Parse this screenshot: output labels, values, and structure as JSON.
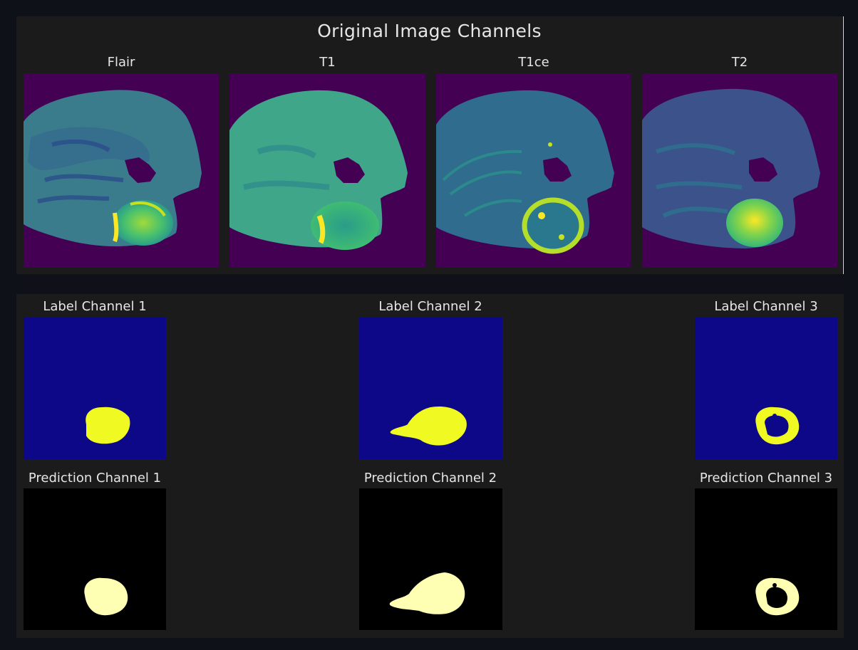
{
  "figure_title": "Original Image Channels",
  "channels": [
    "Flair",
    "T1",
    "T1ce",
    "T2"
  ],
  "label_titles": [
    "Label Channel 1",
    "Label Channel 2",
    "Label Channel 3"
  ],
  "prediction_titles": [
    "Prediction Channel 1",
    "Prediction Channel 2",
    "Prediction Channel 3"
  ],
  "colors": {
    "page_bg": "#0e1117",
    "panel_bg": "#1b1b1b",
    "mri_background": "#440154",
    "label_background": "#0d0887",
    "label_mask": "#f0f921",
    "prediction_background": "#000000",
    "prediction_mask": "#ffffb3"
  }
}
